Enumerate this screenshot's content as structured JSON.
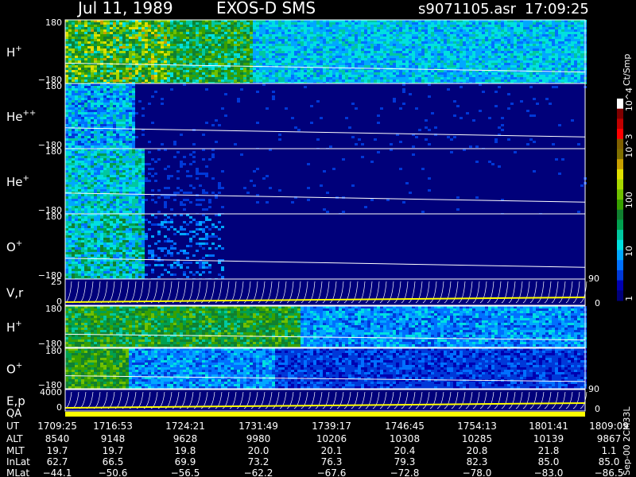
{
  "header": {
    "date": "Jul 11, 1989",
    "instrument": "EXOS-D SMS",
    "file": "s9071105.asr",
    "time": "17:09:25"
  },
  "colorbar": {
    "unit": "Ct/Smp",
    "ticks": [
      "1",
      "10",
      "100",
      "10^3",
      "10^4"
    ],
    "colors": [
      "#00007a",
      "#0000b0",
      "#0038d8",
      "#0070ff",
      "#00a8ff",
      "#00e0e0",
      "#00c8a0",
      "#00a050",
      "#108030",
      "#38a000",
      "#70c000",
      "#a8d800",
      "#e0e000",
      "#c8a000",
      "#807000",
      "#806000",
      "#ff0000",
      "#c00000",
      "#800000",
      "#ffffff"
    ]
  },
  "panels": [
    {
      "label": "H",
      "sup": "+",
      "top": "180",
      "bottom": "−180"
    },
    {
      "label": "He",
      "sup": "++",
      "top": "180",
      "bottom": "−180"
    },
    {
      "label": "He",
      "sup": "+",
      "top": "180",
      "bottom": "−180"
    },
    {
      "label": "O",
      "sup": "+",
      "top": "180",
      "bottom": "−180"
    },
    {
      "label": "V,r",
      "sup": "",
      "top": "25",
      "bottom": "0",
      "right_top": "90",
      "right_bottom": "0"
    },
    {
      "label": "H",
      "sup": "+",
      "top": "180",
      "bottom": "−180"
    },
    {
      "label": "O",
      "sup": "+",
      "top": "180",
      "bottom": "−180"
    },
    {
      "label": "E,p",
      "sup": "",
      "top": "4000",
      "bottom": "0",
      "right_top": "90",
      "right_bottom": "0"
    }
  ],
  "qa_label": "QA",
  "side_note": "Sep-00 2CM33L",
  "chart_data": {
    "type": "heatmap",
    "x_label": "UT",
    "rows": [
      {
        "name": "UT",
        "values": [
          "1709:25",
          "1716:53",
          "1724:21",
          "1731:49",
          "1739:17",
          "1746:45",
          "1754:13",
          "1801:41",
          "1809:09"
        ]
      },
      {
        "name": "ALT",
        "values": [
          "8540",
          "9148",
          "9628",
          "9980",
          "10206",
          "10308",
          "10285",
          "10139",
          "9867"
        ]
      },
      {
        "name": "MLT",
        "values": [
          "19.7",
          "19.7",
          "19.8",
          "20.0",
          "20.1",
          "20.4",
          "20.8",
          "21.8",
          "1.1"
        ]
      },
      {
        "name": "InLat",
        "values": [
          "62.7",
          "66.5",
          "69.9",
          "73.2",
          "76.3",
          "79.3",
          "82.3",
          "85.0",
          "85.0"
        ]
      },
      {
        "name": "MLat",
        "values": [
          "−44.1",
          "−50.6",
          "−56.5",
          "−62.2",
          "−67.6",
          "−72.8",
          "−78.0",
          "−83.0",
          "−86.5"
        ]
      }
    ]
  }
}
